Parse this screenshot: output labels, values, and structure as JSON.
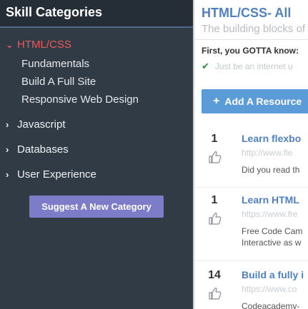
{
  "sidebar": {
    "title": "Skill Categories",
    "categories": [
      {
        "label": "HTML/CSS",
        "expanded": true
      },
      {
        "label": "Javascript",
        "expanded": false
      },
      {
        "label": "Databases",
        "expanded": false
      },
      {
        "label": "User Experience",
        "expanded": false
      }
    ],
    "subcategories": [
      "Fundamentals",
      "Build A Full Site",
      "Responsive Web Design"
    ],
    "suggest_button": "Suggest A New Category"
  },
  "main": {
    "title": "HTML/CSS- All",
    "subtitle": "The building blocks of",
    "know_label": "First, you GOTTA know:",
    "prereq": "Just be an internet u",
    "add_button": "Add A Resource",
    "resources": [
      {
        "count": "1",
        "title": "Learn flexbo",
        "url": "http://www.fle",
        "desc": [
          "Did you read th"
        ]
      },
      {
        "count": "1",
        "title": "Learn HTML",
        "url": "https://www.fre",
        "desc": [
          "Free Code Cam",
          "Interactive as w"
        ]
      },
      {
        "count": "14",
        "title": "Build a fully i",
        "url": "https://www.co",
        "desc": [
          "Codeacademy-"
        ]
      }
    ]
  },
  "colors": {
    "sidebar_bg": "#303b46",
    "active_category": "#ee5959",
    "link_blue": "#4f81c2",
    "suggest_button": "#7c7cc8",
    "add_button": "#5b9bd8",
    "check_green": "#2e8b3a"
  },
  "icons": {
    "expanded": "chevron-down-icon",
    "collapsed": "chevron-right-icon",
    "check": "check-icon",
    "plus": "plus-icon",
    "upvote": "thumbs-up-icon"
  }
}
